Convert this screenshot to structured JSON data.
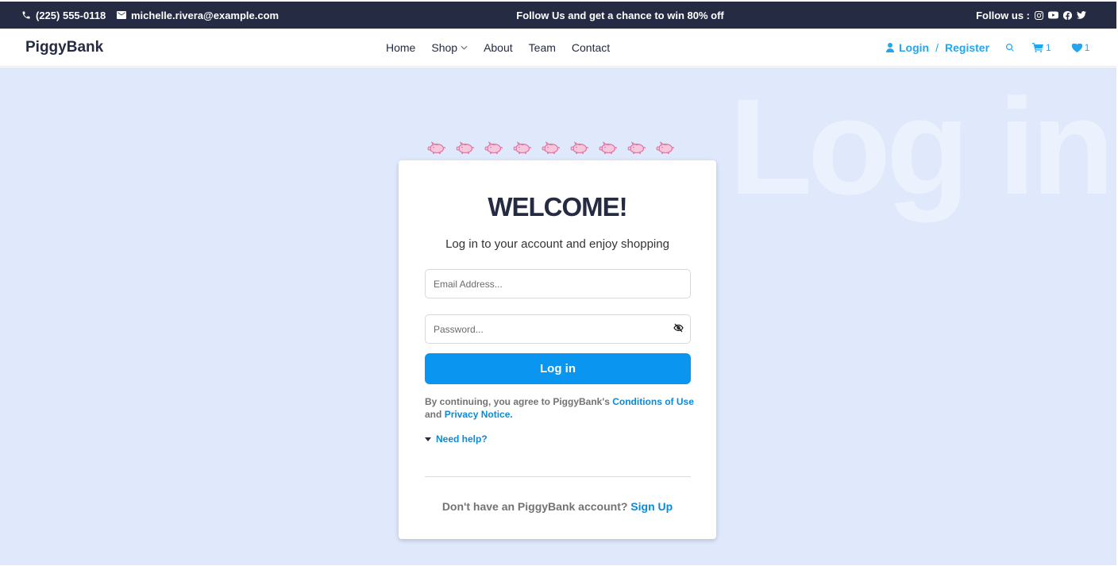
{
  "topbar": {
    "phone": "(225) 555-0118",
    "email": "michelle.rivera@example.com",
    "promo": "Follow Us and get a chance to win 80% off",
    "follow_label": "Follow us :",
    "social_icons": [
      "instagram-icon",
      "youtube-icon",
      "facebook-icon",
      "twitter-icon"
    ]
  },
  "nav": {
    "brand": "PiggyBank",
    "menu": [
      "Home",
      "Shop",
      "About",
      "Team",
      "Contact"
    ],
    "login": "Login",
    "separator": "/",
    "register": "Register",
    "cart_count": "1",
    "wishlist_count": "1"
  },
  "main": {
    "watermark": "Log in",
    "pig_count": 9
  },
  "card": {
    "title": "WELCOME!",
    "subtitle": "Log in to your account and enjoy shopping",
    "email_placeholder": "Email Address...",
    "password_placeholder": "Password...",
    "login_button": "Log in",
    "terms_prefix": "By continuing, you agree to PiggyBank's",
    "terms_link": "Conditions of Use",
    "terms_and": "and",
    "privacy_link": "Privacy Notice.",
    "need_help": "Need help?",
    "signup_prompt": "Don't have an PiggyBank account?",
    "signup_link": "Sign Up"
  },
  "colors": {
    "dark": "#252b42",
    "accent": "#23a6f0",
    "button": "#0a96f0",
    "background": "#dfe9fb",
    "pig": "#d77aa6"
  }
}
